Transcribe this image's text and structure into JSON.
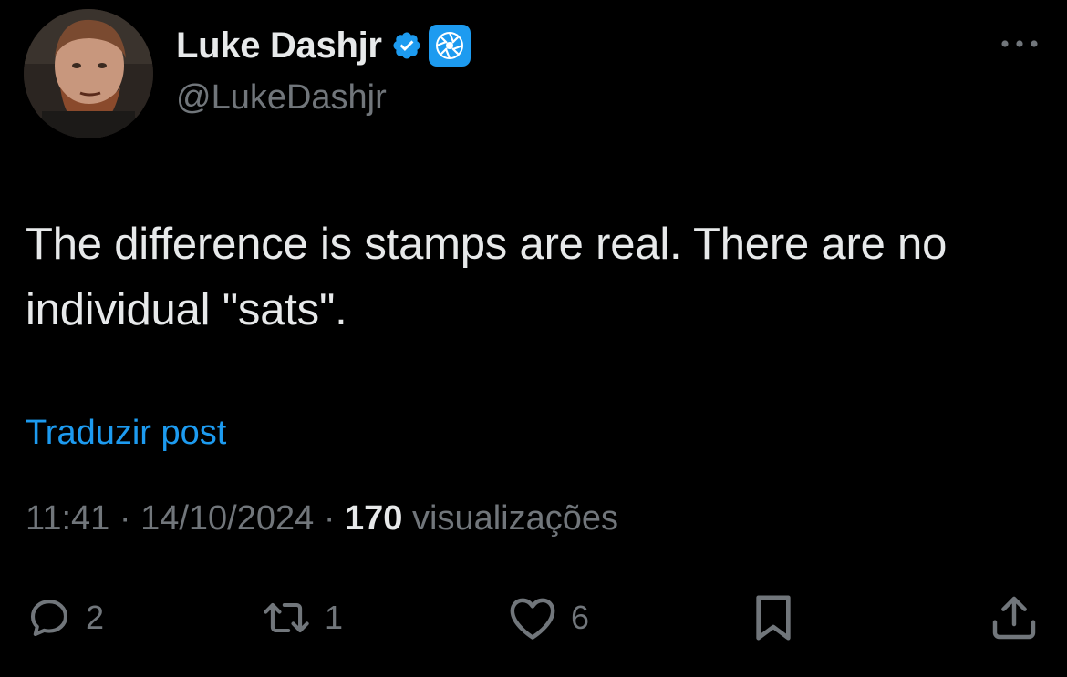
{
  "author": {
    "display_name": "Luke Dashjr",
    "handle": "@LukeDashjr",
    "verified_icon": "verified-badge-icon",
    "affiliate_icon": "affiliate-badge-icon"
  },
  "tweet": {
    "text": "The difference is stamps are real. There are no individual \"sats\".",
    "translate_link": "Traduzir post",
    "time": "11:41",
    "date": "14/10/2024",
    "separator": "·",
    "views_count": "170",
    "views_label": "visualizações"
  },
  "actions": {
    "replies": "2",
    "retweets": "1",
    "likes": "6"
  },
  "colors": {
    "background": "#000000",
    "primary_text": "#e7e9ea",
    "secondary_text": "#71767b",
    "accent": "#1d9bf0"
  }
}
